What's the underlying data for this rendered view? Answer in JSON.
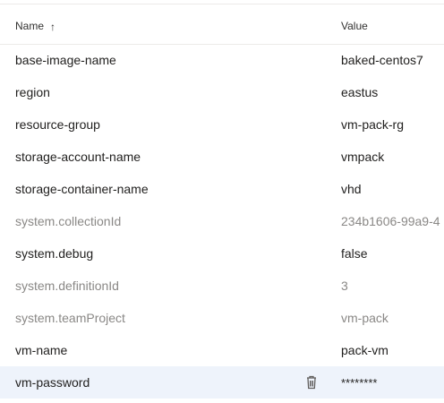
{
  "table": {
    "columns": {
      "name": "Name",
      "value": "Value"
    },
    "sort": {
      "column": "name",
      "direction": "ascending",
      "indicator": "↑"
    },
    "rows": [
      {
        "name": "base-image-name",
        "value": "baked-centos7",
        "system": false
      },
      {
        "name": "region",
        "value": "eastus",
        "system": false
      },
      {
        "name": "resource-group",
        "value": "vm-pack-rg",
        "system": false
      },
      {
        "name": "storage-account-name",
        "value": "vmpack",
        "system": false
      },
      {
        "name": "storage-container-name",
        "value": "vhd",
        "system": false
      },
      {
        "name": "system.collectionId",
        "value": "234b1606-99a9-4",
        "system": true
      },
      {
        "name": "system.debug",
        "value": "false",
        "system": false
      },
      {
        "name": "system.definitionId",
        "value": "3",
        "system": true
      },
      {
        "name": "system.teamProject",
        "value": "vm-pack",
        "system": true
      },
      {
        "name": "vm-name",
        "value": "pack-vm",
        "system": false
      },
      {
        "name": "vm-password",
        "value": "********",
        "system": false,
        "selected": true,
        "secret": true
      }
    ],
    "row_actions": {
      "delete_icon": "trash-icon"
    },
    "colors": {
      "selected_row": "#eef3fb",
      "system_text": "#8a8886",
      "text": "#201f1e",
      "divider": "#edebe9"
    }
  }
}
